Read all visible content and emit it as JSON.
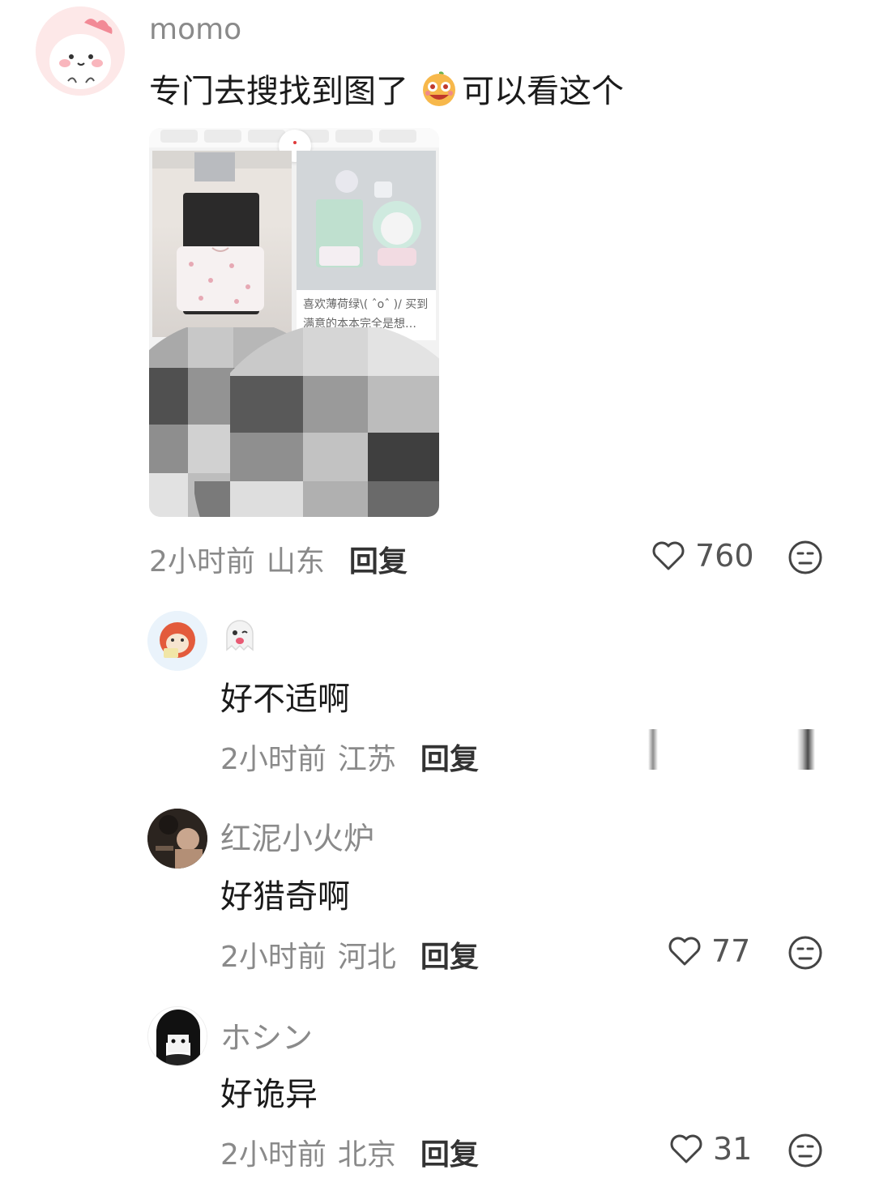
{
  "post": {
    "username": "momo",
    "text": "专门去搜找到图了",
    "text_after": "可以看这个",
    "image": {
      "caption": "喜欢薄荷绿\\( ˆoˆ )/ 买到满意的本本完全是想…"
    },
    "time": "2小时前",
    "location": "山东",
    "reply_label": "回复",
    "likes": "760"
  },
  "replies": [
    {
      "username": "",
      "username_icon": "ghost-emoji-icon",
      "text": "好不适啊",
      "time": "2小时前",
      "location": "江苏",
      "reply_label": "回复",
      "likes": ""
    },
    {
      "username": "红泥小火炉",
      "text": "好猎奇啊",
      "time": "2小时前",
      "location": "河北",
      "reply_label": "回复",
      "likes": "77"
    },
    {
      "username": "ホシン",
      "text": "好诡异",
      "time": "2小时前",
      "location": "北京",
      "reply_label": "回复",
      "likes": "31"
    }
  ],
  "colors": {
    "meta_text": "#8a8a8a",
    "username": "#8a8a8a",
    "body_text": "#1a1a1a",
    "reply_label": "#333333",
    "avatar_pink": "#fbe3e3"
  }
}
